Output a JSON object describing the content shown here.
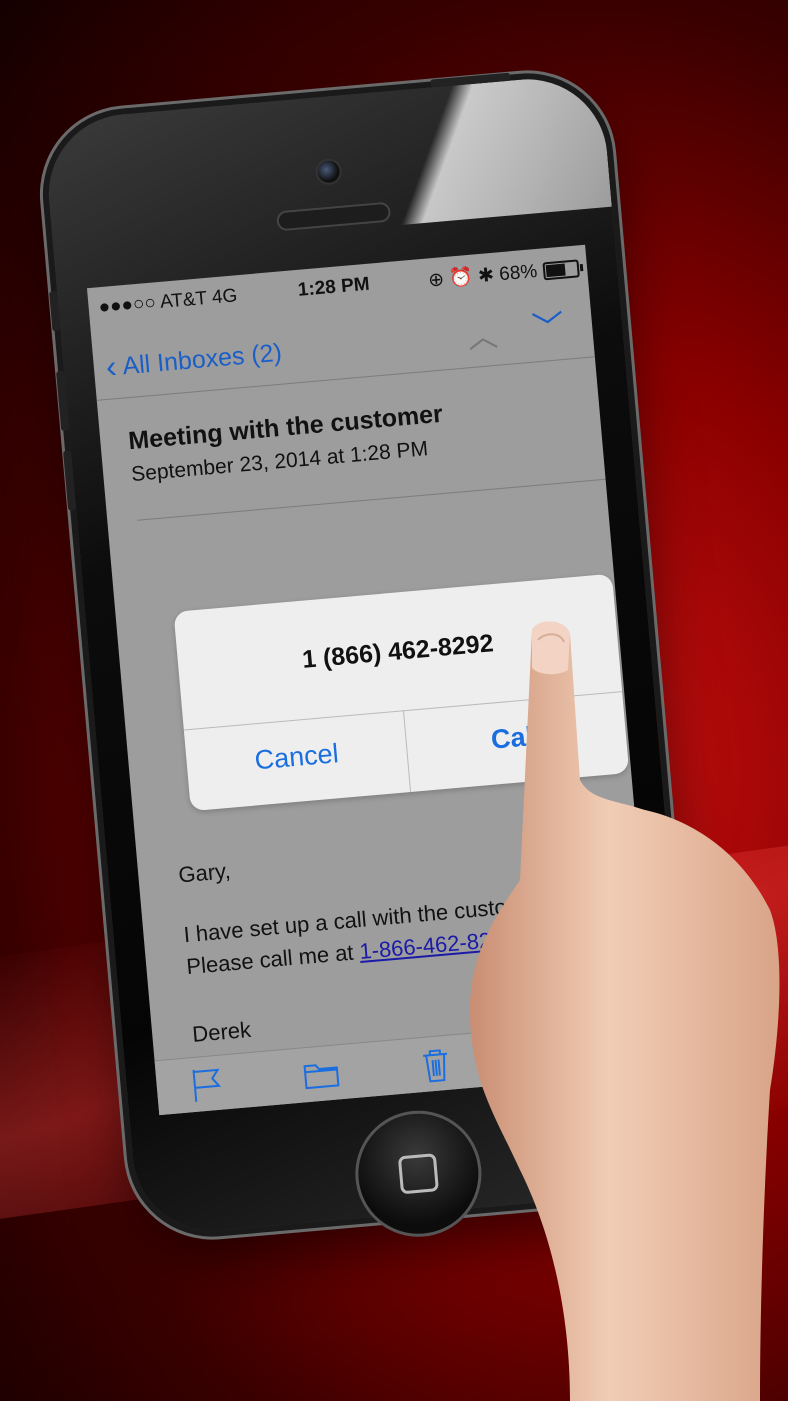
{
  "status_bar": {
    "carrier": "●●●○○ AT&T  4G",
    "time": "1:28 PM",
    "indicators": "⊕ ⏰ ✱ 68%",
    "battery_percent": 68
  },
  "nav": {
    "back_label": "All Inboxes (2)",
    "back_icon": "chevron-left-icon",
    "prev_icon": "chevron-up-icon",
    "next_icon": "chevron-down-icon"
  },
  "email": {
    "subject": "Meeting with the customer",
    "date": "September 23, 2014 at 1:28 PM",
    "greeting": "Gary,",
    "line1": "I have set up a call with the custon",
    "line2_prefix": "Please call me at ",
    "phone_link": "1-866-462-8292",
    "signature": "Derek"
  },
  "alert": {
    "number": "1 (866) 462-8292",
    "cancel_label": "Cancel",
    "call_label": "Call"
  },
  "toolbar": {
    "icons": [
      "flag-icon",
      "folder-icon",
      "trash-icon"
    ]
  },
  "colors": {
    "accent": "#1a6ee0",
    "link": "#1a1aa8",
    "background": "#9a0000"
  }
}
